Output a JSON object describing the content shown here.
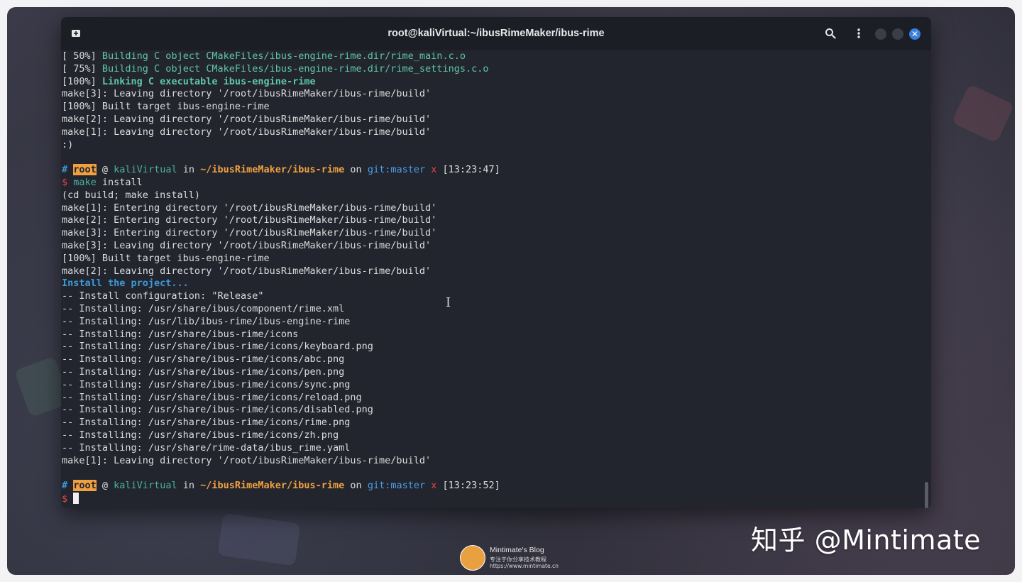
{
  "window": {
    "title": "root@kaliVirtual:~/ibusRimeMaker/ibus-rime",
    "icons": {
      "new_tab": "new-tab-icon",
      "search": "search-icon",
      "menu": "kebab-menu-icon",
      "close": "close-icon"
    }
  },
  "terminal": {
    "lines": [
      [
        {
          "t": "[ 50%] ",
          "c": "white"
        },
        {
          "t": "Building C object CMakeFiles/ibus-engine-rime.dir/rime_main.c.o",
          "c": "green"
        }
      ],
      [
        {
          "t": "[ 75%] ",
          "c": "white"
        },
        {
          "t": "Building C object CMakeFiles/ibus-engine-rime.dir/rime_settings.c.o",
          "c": "green"
        }
      ],
      [
        {
          "t": "[100%] ",
          "c": "white"
        },
        {
          "t": "Linking C executable ibus-engine-rime",
          "c": "greenb"
        }
      ],
      [
        {
          "t": "make[3]: Leaving directory '/root/ibusRimeMaker/ibus-rime/build'",
          "c": "white"
        }
      ],
      [
        {
          "t": "[100%] Built target ibus-engine-rime",
          "c": "white"
        }
      ],
      [
        {
          "t": "make[2]: Leaving directory '/root/ibusRimeMaker/ibus-rime/build'",
          "c": "white"
        }
      ],
      [
        {
          "t": "make[1]: Leaving directory '/root/ibusRimeMaker/ibus-rime/build'",
          "c": "white"
        }
      ],
      [
        {
          "t": ":)",
          "c": "white"
        }
      ],
      [],
      [
        {
          "t": "# ",
          "c": "blueb"
        },
        {
          "t": "root",
          "c": "roothl"
        },
        {
          "t": " @ ",
          "c": "white"
        },
        {
          "t": "kaliVirtual",
          "c": "teal"
        },
        {
          "t": " in ",
          "c": "white"
        },
        {
          "t": "~/ibusRimeMaker/ibus-rime",
          "c": "orange"
        },
        {
          "t": " on ",
          "c": "white"
        },
        {
          "t": "git:master",
          "c": "blue"
        },
        {
          "t": " x ",
          "c": "red"
        },
        {
          "t": "[13:23:47]",
          "c": "white"
        }
      ],
      [
        {
          "t": "$ ",
          "c": "red"
        },
        {
          "t": "make",
          "c": "teal"
        },
        {
          "t": " install",
          "c": "white"
        }
      ],
      [
        {
          "t": "(cd build; make install)",
          "c": "white"
        }
      ],
      [
        {
          "t": "make[1]: Entering directory '/root/ibusRimeMaker/ibus-rime/build'",
          "c": "white"
        }
      ],
      [
        {
          "t": "make[2]: Entering directory '/root/ibusRimeMaker/ibus-rime/build'",
          "c": "white"
        }
      ],
      [
        {
          "t": "make[3]: Entering directory '/root/ibusRimeMaker/ibus-rime/build'",
          "c": "white"
        }
      ],
      [
        {
          "t": "make[3]: Leaving directory '/root/ibusRimeMaker/ibus-rime/build'",
          "c": "white"
        }
      ],
      [
        {
          "t": "[100%] Built target ibus-engine-rime",
          "c": "white"
        }
      ],
      [
        {
          "t": "make[2]: Leaving directory '/root/ibusRimeMaker/ibus-rime/build'",
          "c": "white"
        }
      ],
      [
        {
          "t": "Install the project...",
          "c": "blueb"
        }
      ],
      [
        {
          "t": "-- Install configuration: \"Release\"",
          "c": "white"
        }
      ],
      [
        {
          "t": "-- Installing: /usr/share/ibus/component/rime.xml",
          "c": "white"
        }
      ],
      [
        {
          "t": "-- Installing: /usr/lib/ibus-rime/ibus-engine-rime",
          "c": "white"
        }
      ],
      [
        {
          "t": "-- Installing: /usr/share/ibus-rime/icons",
          "c": "white"
        }
      ],
      [
        {
          "t": "-- Installing: /usr/share/ibus-rime/icons/keyboard.png",
          "c": "white"
        }
      ],
      [
        {
          "t": "-- Installing: /usr/share/ibus-rime/icons/abc.png",
          "c": "white"
        }
      ],
      [
        {
          "t": "-- Installing: /usr/share/ibus-rime/icons/pen.png",
          "c": "white"
        }
      ],
      [
        {
          "t": "-- Installing: /usr/share/ibus-rime/icons/sync.png",
          "c": "white"
        }
      ],
      [
        {
          "t": "-- Installing: /usr/share/ibus-rime/icons/reload.png",
          "c": "white"
        }
      ],
      [
        {
          "t": "-- Installing: /usr/share/ibus-rime/icons/disabled.png",
          "c": "white"
        }
      ],
      [
        {
          "t": "-- Installing: /usr/share/ibus-rime/icons/rime.png",
          "c": "white"
        }
      ],
      [
        {
          "t": "-- Installing: /usr/share/ibus-rime/icons/zh.png",
          "c": "white"
        }
      ],
      [
        {
          "t": "-- Installing: /usr/share/rime-data/ibus_rime.yaml",
          "c": "white"
        }
      ],
      [
        {
          "t": "make[1]: Leaving directory '/root/ibusRimeMaker/ibus-rime/build'",
          "c": "white"
        }
      ],
      [],
      [
        {
          "t": "# ",
          "c": "blueb"
        },
        {
          "t": "root",
          "c": "roothl"
        },
        {
          "t": " @ ",
          "c": "white"
        },
        {
          "t": "kaliVirtual",
          "c": "teal"
        },
        {
          "t": " in ",
          "c": "white"
        },
        {
          "t": "~/ibusRimeMaker/ibus-rime",
          "c": "orange"
        },
        {
          "t": " on ",
          "c": "white"
        },
        {
          "t": "git:master",
          "c": "blue"
        },
        {
          "t": " x ",
          "c": "red"
        },
        {
          "t": "[13:23:52]",
          "c": "white"
        }
      ],
      [
        {
          "t": "$ ",
          "c": "red"
        },
        {
          "t": "",
          "c": "cursor"
        }
      ]
    ]
  },
  "overlay": {
    "watermark": "知乎 @Mintimate",
    "blog_name": "Mintimate's Blog",
    "blog_subtitle": "专注于你分享技术教程",
    "blog_url": "https://www.mintimate.cn"
  },
  "colors": {
    "accent_close": "#3a7fe0",
    "prompt_user_bg": "#f0a040",
    "build_green": "#5fc5a8"
  }
}
